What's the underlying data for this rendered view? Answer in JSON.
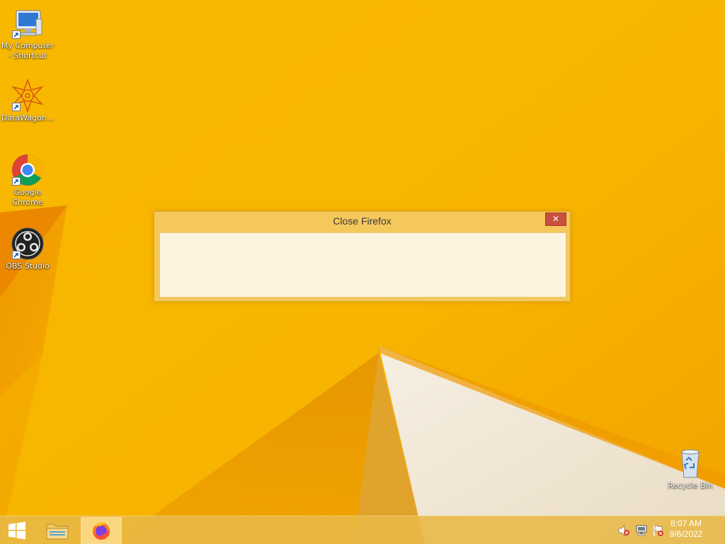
{
  "desktop_icons": [
    {
      "label": "My Computer - Shortcut",
      "icon": "computer-icon",
      "shortcut": true
    },
    {
      "label": "DataWagon...",
      "icon": "datawagon-icon",
      "shortcut": true
    },
    {
      "label": "Google Chrome",
      "icon": "chrome-icon",
      "shortcut": true
    },
    {
      "label": "OBS Studio",
      "icon": "obs-icon",
      "shortcut": true
    },
    {
      "label": "Recycle Bin",
      "icon": "recycle-bin-icon",
      "shortcut": false
    }
  ],
  "dialog": {
    "title": "Close Firefox",
    "close_glyph": "✕"
  },
  "taskbar": {
    "apps": [
      "start-icon",
      "file-explorer-icon",
      "firefox-icon"
    ],
    "tray_icons": [
      "volume-muted-icon",
      "network-icon",
      "action-center-flag-icon"
    ],
    "clock": {
      "time": "8:07 AM",
      "date": "9/6/2022"
    }
  },
  "colors": {
    "wallpaper": "#f6b400",
    "dialog_frame": "#f5c85c",
    "dialog_client": "#fdf4e0",
    "close_button": "#c7503e",
    "taskbar": "#e8b846"
  }
}
